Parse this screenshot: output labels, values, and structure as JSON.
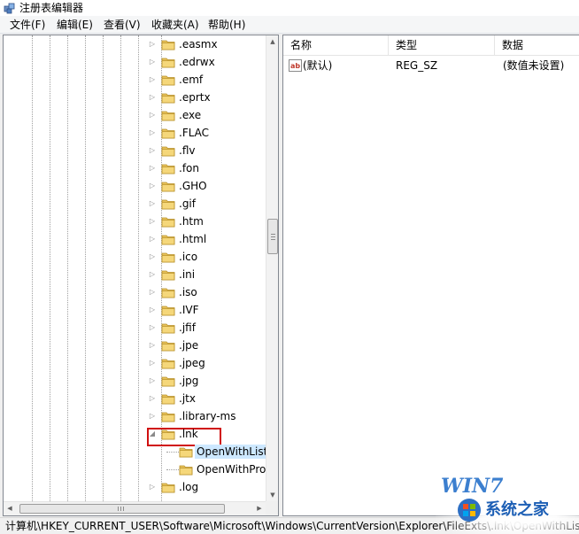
{
  "window": {
    "title": "注册表编辑器"
  },
  "menu": [
    "文件(F)",
    "编辑(E)",
    "查看(V)",
    "收藏夹(A)",
    "帮助(H)"
  ],
  "tree": {
    "nodes": [
      {
        "label": ".easmx",
        "expanded": false
      },
      {
        "label": ".edrwx",
        "expanded": false
      },
      {
        "label": ".emf",
        "expanded": false
      },
      {
        "label": ".eprtx",
        "expanded": false
      },
      {
        "label": ".exe",
        "expanded": false
      },
      {
        "label": ".FLAC",
        "expanded": false
      },
      {
        "label": ".flv",
        "expanded": false
      },
      {
        "label": ".fon",
        "expanded": false
      },
      {
        "label": ".GHO",
        "expanded": false
      },
      {
        "label": ".gif",
        "expanded": false
      },
      {
        "label": ".htm",
        "expanded": false
      },
      {
        "label": ".html",
        "expanded": false
      },
      {
        "label": ".ico",
        "expanded": false
      },
      {
        "label": ".ini",
        "expanded": false
      },
      {
        "label": ".iso",
        "expanded": false
      },
      {
        "label": ".IVF",
        "expanded": false
      },
      {
        "label": ".jfif",
        "expanded": false
      },
      {
        "label": ".jpe",
        "expanded": false
      },
      {
        "label": ".jpeg",
        "expanded": false
      },
      {
        "label": ".jpg",
        "expanded": false
      },
      {
        "label": ".jtx",
        "expanded": false
      },
      {
        "label": ".library-ms",
        "expanded": false
      },
      {
        "label": ".lnk",
        "expanded": true,
        "highlighted": true
      },
      {
        "label": "OpenWithList",
        "child": true,
        "selected": true
      },
      {
        "label": "OpenWithProgids",
        "child": true
      },
      {
        "label": ".log",
        "expanded": false
      }
    ]
  },
  "values": {
    "columns": {
      "name": "名称",
      "type": "类型",
      "data": "数据"
    },
    "rows": [
      {
        "name": "(默认)",
        "type": "REG_SZ",
        "data": "(数值未设置)",
        "icon": "string-value-icon"
      }
    ]
  },
  "status": {
    "path": "计算机\\HKEY_CURRENT_USER\\Software\\Microsoft\\Windows\\CurrentVersion\\Explorer\\FileExts\\.lnk\\OpenWithList"
  },
  "watermark": {
    "line1": "WIN7",
    "line2": "系统之家"
  },
  "colors": {
    "highlight_box": "#d01010",
    "selection": "#cde8ff",
    "folder": "#e8c25a"
  }
}
